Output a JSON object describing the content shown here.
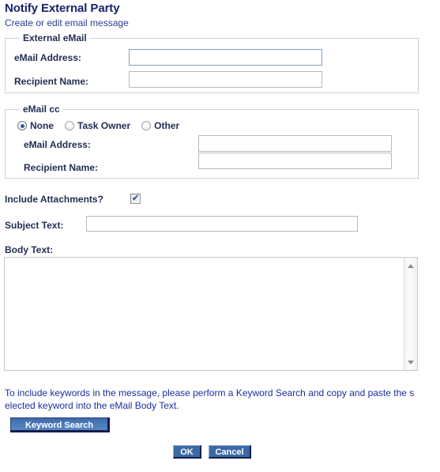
{
  "header": {
    "title": "Notify External Party",
    "subtitle": "Create or edit email message"
  },
  "external_email": {
    "legend": "External eMail",
    "fields": [
      {
        "label": "eMail Address:",
        "value": "",
        "placeholder": "",
        "focused": true
      },
      {
        "label": "Recipient Name:",
        "value": "",
        "placeholder": "",
        "focused": false
      }
    ]
  },
  "email_cc": {
    "legend": "eMail cc",
    "radios": [
      {
        "label": "None",
        "selected": true
      },
      {
        "label": "Task Owner",
        "selected": false
      },
      {
        "label": "Other",
        "selected": false
      }
    ],
    "fields": [
      {
        "label": "eMail Address:",
        "value": "",
        "placeholder": ""
      },
      {
        "label": "Recipient Name:",
        "value": "",
        "placeholder": ""
      }
    ]
  },
  "attachments": {
    "label": "Include Attachments?",
    "checked": true,
    "check_glyph": "✔"
  },
  "subject": {
    "label": "Subject Text:",
    "value": "",
    "placeholder": ""
  },
  "body": {
    "label": "Body Text:",
    "value": "",
    "placeholder": "",
    "scrollbar": {
      "up_arrow": "up-arrow-icon",
      "down_arrow": "down-arrow-icon"
    }
  },
  "hint": {
    "text": "To include keywords in the message, please perform a Keyword Search and copy and paste the selected keyword into the eMail Body Text."
  },
  "buttons": {
    "keyword_search": "Keyword Search",
    "ok": "OK",
    "cancel": "Cancel"
  },
  "colors": {
    "title": "#16246b",
    "subtitle": "#2b3f94",
    "label": "#1f2d52",
    "hint": "#1c2f9e",
    "button_blue": "#3c69a6",
    "button_dark_edge": "#151b4d",
    "radio_dot": "#2a5fa5",
    "check": "#3b62a8",
    "fieldset_border": "#c8d4e0",
    "input_border": "#b8b8b8",
    "input_border_focus": "#7fa3c4"
  }
}
